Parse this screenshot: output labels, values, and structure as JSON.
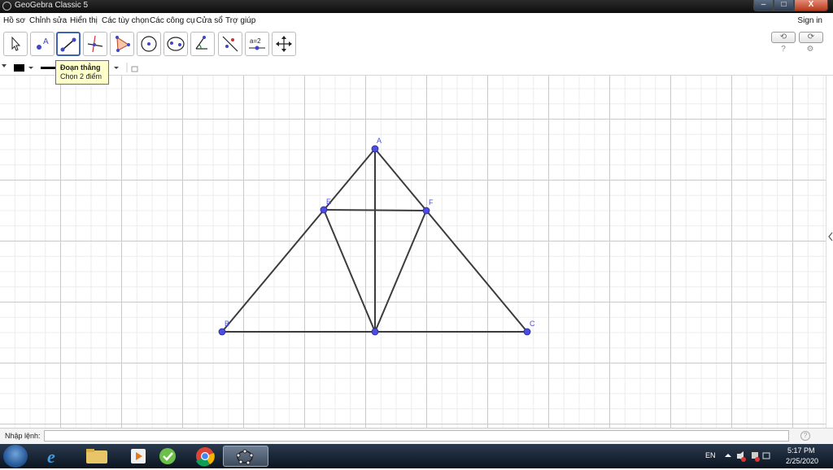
{
  "window": {
    "title": "GeoGebra Classic 5",
    "buttons": {
      "minimize": "–",
      "maximize": "□",
      "close": "X"
    }
  },
  "menubar": {
    "items": [
      "Hồ sơ",
      "Chỉnh sửa",
      "Hiển thị",
      "Các tùy chọn",
      "Các công cụ",
      "Cửa sổ",
      "Trợ giúp"
    ],
    "sign_in": "Sign in"
  },
  "toolbar": {
    "tools": [
      {
        "name": "move-tool-icon"
      },
      {
        "name": "point-tool-icon",
        "label": "A"
      },
      {
        "name": "segment-tool-icon",
        "active": true
      },
      {
        "name": "perpendicular-line-tool-icon"
      },
      {
        "name": "polygon-tool-icon"
      },
      {
        "name": "circle-center-tool-icon"
      },
      {
        "name": "ellipse-tool-icon"
      },
      {
        "name": "angle-tool-icon"
      },
      {
        "name": "reflect-tool-icon"
      },
      {
        "name": "slider-tool-icon",
        "label": "a=2"
      },
      {
        "name": "move-graphics-tool-icon"
      }
    ],
    "undo_icon": "undo-icon",
    "redo_icon": "redo-icon",
    "help_icon": "help-icon",
    "settings_icon": "gear-icon"
  },
  "tooltip": {
    "title": "Đoạn thẳng",
    "subtitle": "Chọn 2 điểm"
  },
  "stylebar": {
    "color": "#000000"
  },
  "construction": {
    "point_color": "#4d4de6",
    "line_color": "#3c3c3c",
    "points": [
      {
        "label": "A"
      },
      {
        "label": "B"
      },
      {
        "label": "C"
      },
      {
        "label": "E"
      },
      {
        "label": "F"
      },
      {
        "label": ""
      }
    ]
  },
  "input_bar": {
    "label": "Nhập lệnh:",
    "value": "",
    "help": "?"
  },
  "taskbar": {
    "apps": [
      "windows-start-icon",
      "internet-explorer-icon",
      "file-explorer-icon",
      "media-player-icon",
      "app-icon",
      "chrome-icon",
      "geogebra-icon"
    ],
    "language": "EN",
    "time": "5:17 PM",
    "date": "2/25/2020"
  }
}
